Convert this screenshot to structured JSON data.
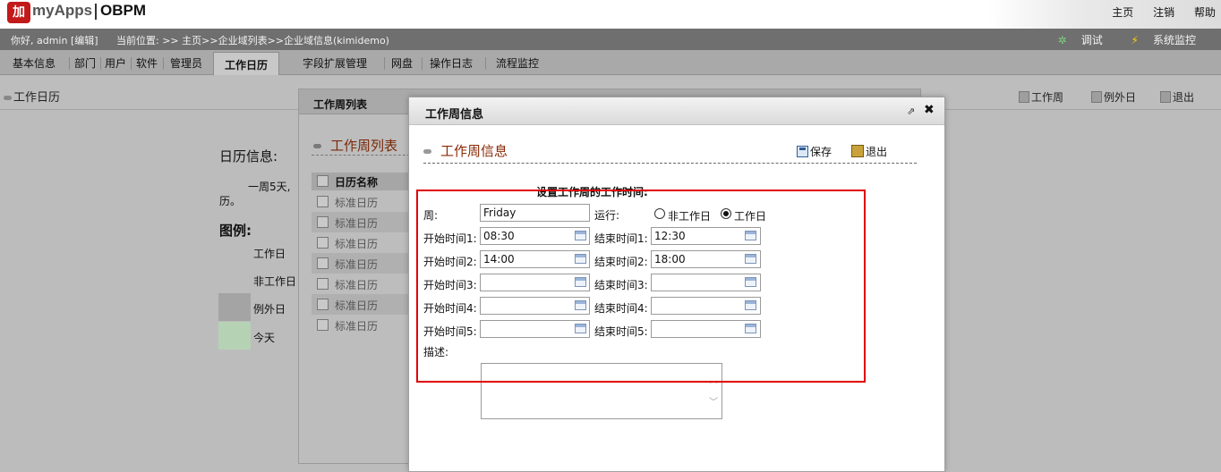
{
  "header": {
    "logo_mark": "加",
    "logo_text": "myApps",
    "logo_text2": "OBPM",
    "links": [
      "主页",
      "注销",
      "帮助"
    ]
  },
  "userbar": {
    "greeting": "你好, admin [编辑]",
    "location": "当前位置: >> 主页>>企业域列表>>企业域信息(kimidemo)",
    "debug": "调试",
    "monitor": "系统监控"
  },
  "nav": {
    "tabs": [
      "基本信息",
      "部门",
      "用户",
      "软件",
      "管理员",
      "工作日历",
      "字段扩展管理",
      "网盘",
      "操作日志",
      "流程监控"
    ],
    "active": "工作日历"
  },
  "page": {
    "title": "工作日历",
    "buttons": [
      "工作周",
      "例外日",
      "退出"
    ],
    "calendar_info_title": "日历信息:",
    "calendar_desc": "一周5天,",
    "calendar_desc2": "历。",
    "legend_title": "图例:",
    "legend": [
      {
        "label": "工作日",
        "color": "#bcbcbc"
      },
      {
        "label": "非工作日",
        "color": "#bcbcbc"
      },
      {
        "label": "例外日",
        "color": "#a4a4a4"
      },
      {
        "label": "今天",
        "color": "#b6d2b4"
      }
    ]
  },
  "dialog1": {
    "title": "工作周列表",
    "list_title": "工作周列表",
    "column": "日历名称",
    "rows": [
      "标准日历",
      "标准日历",
      "标准日历",
      "标准日历",
      "标准日历",
      "标准日历",
      "标准日历"
    ]
  },
  "dialog2": {
    "title": "工作周信息",
    "section_title": "工作周信息",
    "save": "保存",
    "exit": "退出",
    "form_heading": "设置工作周的工作时间:",
    "week_label": "周:",
    "week_value": "Friday",
    "run_label": "运行:",
    "radio_non_workday": "非工作日",
    "radio_workday": "工作日",
    "times": [
      {
        "start_label": "开始时间1:",
        "start": "08:30",
        "end_label": "结束时间1:",
        "end": "12:30"
      },
      {
        "start_label": "开始时间2:",
        "start": "14:00",
        "end_label": "结束时间2:",
        "end": "18:00"
      },
      {
        "start_label": "开始时间3:",
        "start": "",
        "end_label": "结束时间3:",
        "end": ""
      },
      {
        "start_label": "开始时间4:",
        "start": "",
        "end_label": "结束时间4:",
        "end": ""
      },
      {
        "start_label": "开始时间5:",
        "start": "",
        "end_label": "结束时间5:",
        "end": ""
      }
    ],
    "desc_label": "描述:"
  },
  "colors": {
    "highlight": "#e00000",
    "title_accent": "#8a2a05"
  }
}
